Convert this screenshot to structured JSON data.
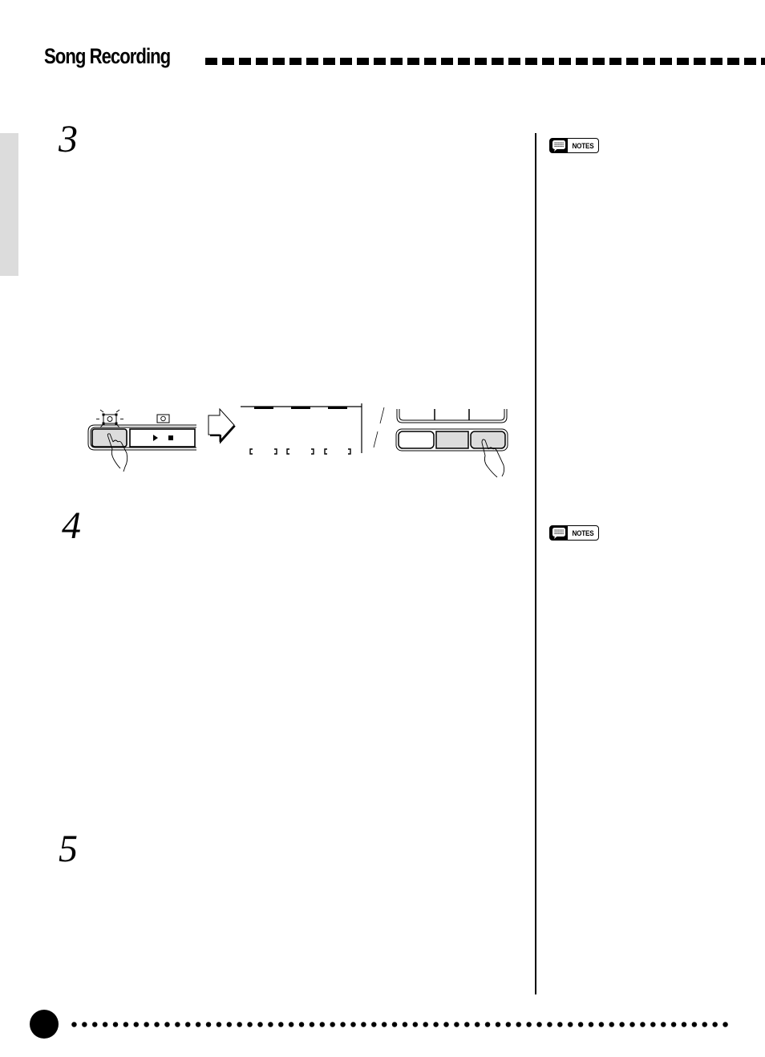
{
  "header": {
    "title": "Song Recording"
  },
  "steps": [
    {
      "number": "3"
    },
    {
      "number": "4"
    },
    {
      "number": "5"
    }
  ],
  "notes": [
    {
      "label": "NOTES",
      "icon": "notes-icon"
    },
    {
      "label": "NOTES",
      "icon": "notes-icon"
    }
  ],
  "illustration": {
    "record_button": {
      "icon": "record-icon",
      "state": "flashing"
    },
    "play_stop_button": {
      "icons": [
        "play-icon",
        "stop-icon"
      ],
      "indicator_icon": "record-icon"
    },
    "arrow": {
      "icon": "arrow-right-icon"
    },
    "track_buttons": {
      "rows": 2,
      "columns": 3,
      "highlighted": [
        [
          2,
          2
        ],
        [
          2,
          3
        ]
      ]
    }
  },
  "footer": {
    "page_number": ""
  }
}
